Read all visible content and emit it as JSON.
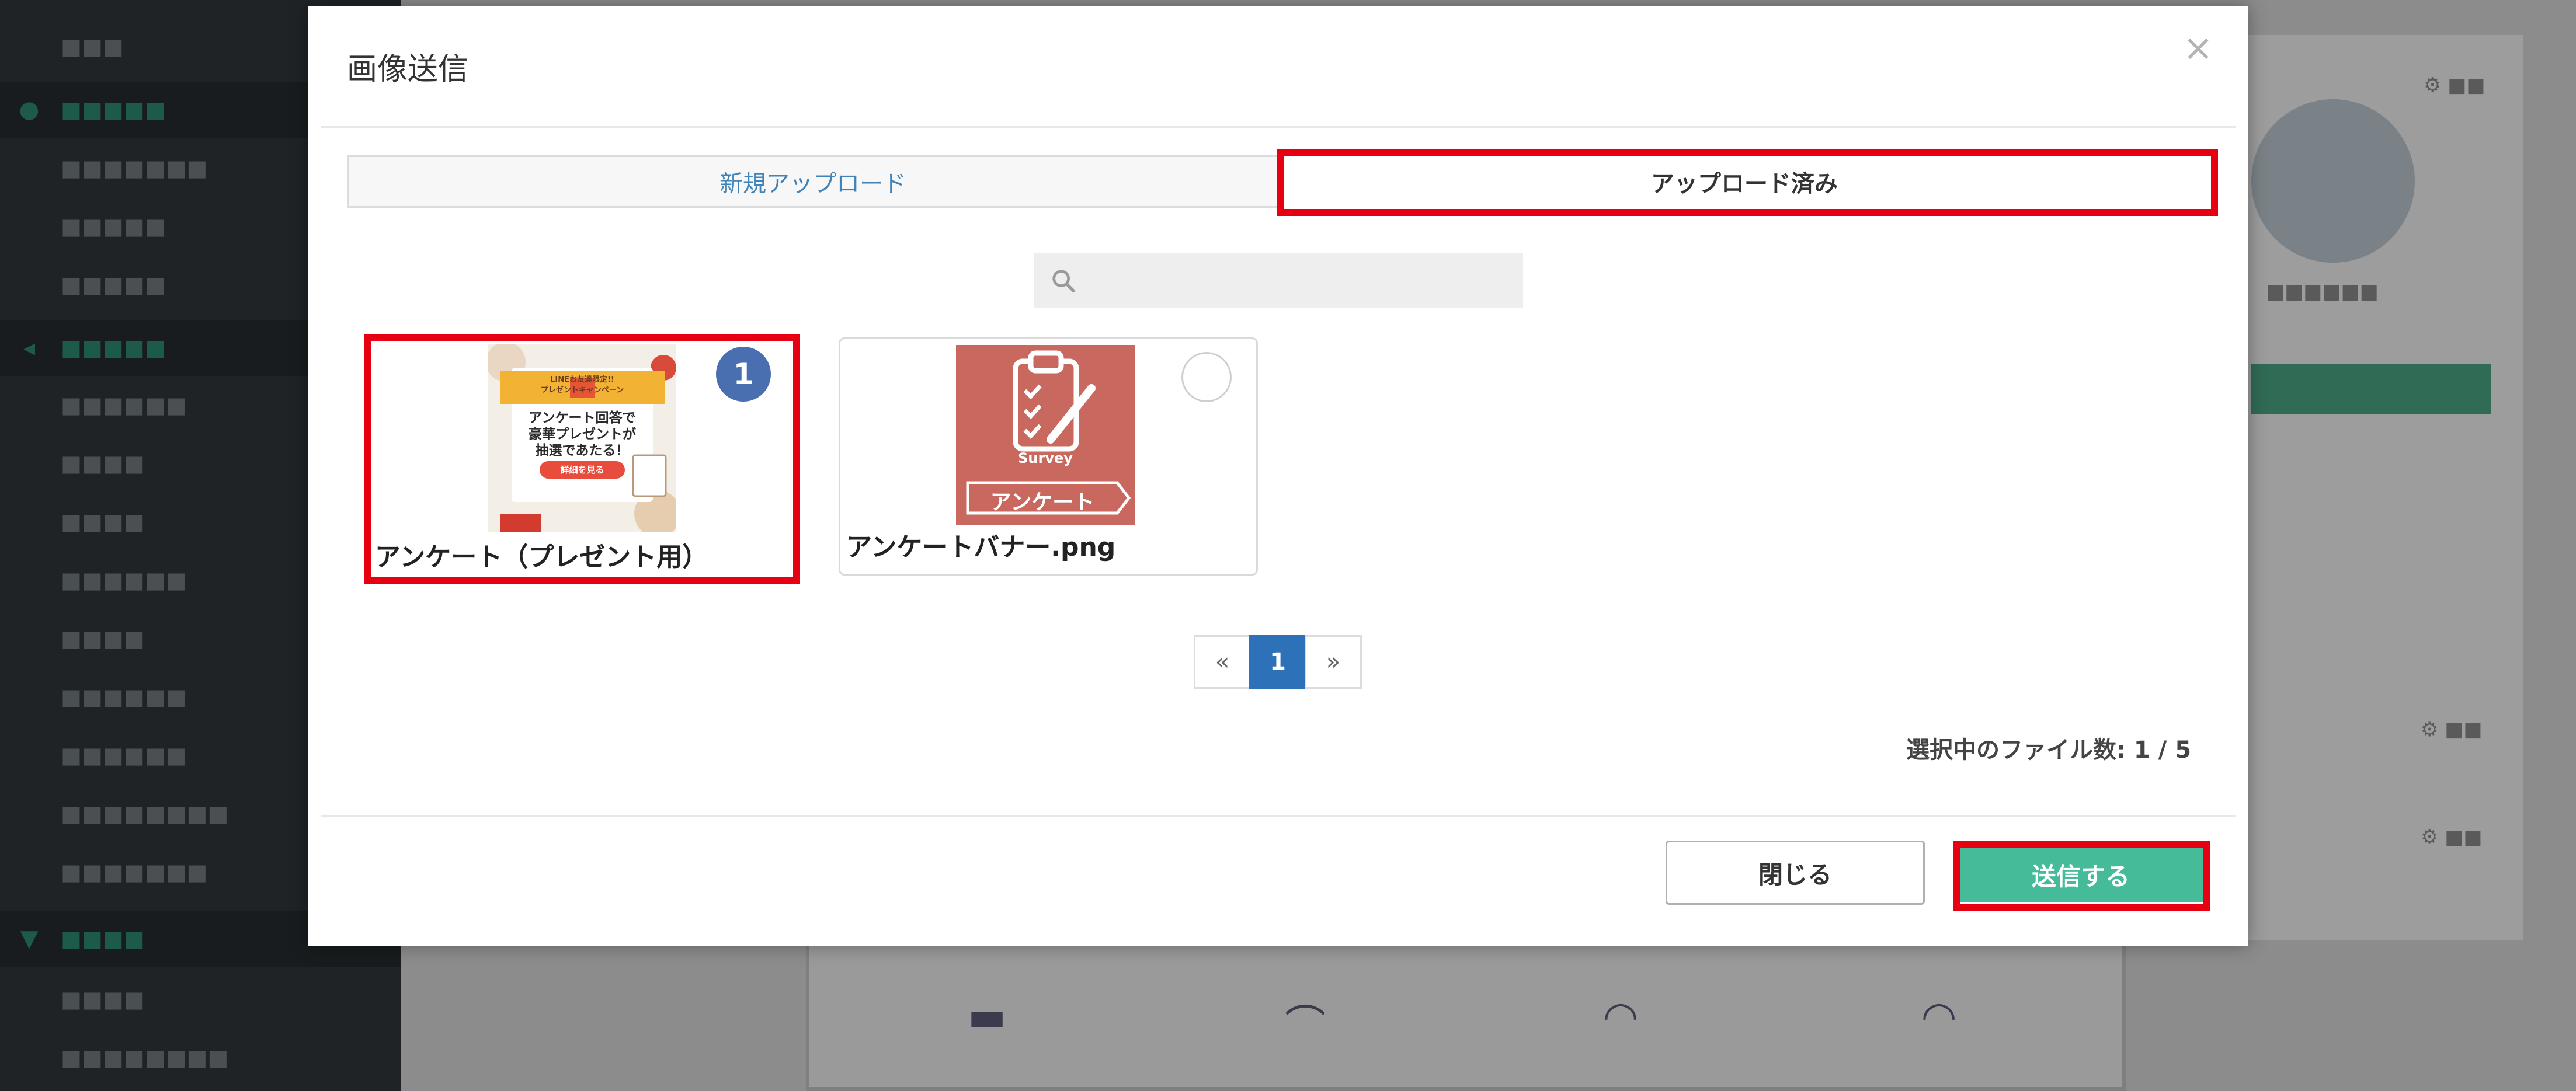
{
  "modal": {
    "title": "画像送信",
    "tabs": [
      {
        "label": "新規アップロード",
        "active": false
      },
      {
        "label": "アップロード済み",
        "active": true
      }
    ],
    "search": {
      "placeholder": "",
      "value": ""
    },
    "images": [
      {
        "label": "アンケート（プレゼント用）",
        "selected": true,
        "order": "1",
        "thumb_text": {
          "line1": "LINEお友達限定!!",
          "line2": "プレゼントキャンペーン",
          "line3": "アンケート回答で",
          "line4": "豪華プレゼントが",
          "line5": "抽選であたる！",
          "button": "詳細を見る"
        }
      },
      {
        "label": "アンケートバナー.png",
        "selected": false,
        "thumb_text": {
          "survey": "Survey",
          "banner": "アンケート"
        }
      }
    ],
    "pagination": {
      "prev": "«",
      "current": "1",
      "next": "»"
    },
    "selection_count": "選択中のファイル数: 1 / 5",
    "buttons": {
      "close": "閉じる",
      "send": "送信する"
    }
  },
  "colors": {
    "accent": "#45bb9a",
    "primary": "#2d72b8",
    "highlight": "#e60012",
    "badge": "#4a6fb0"
  }
}
